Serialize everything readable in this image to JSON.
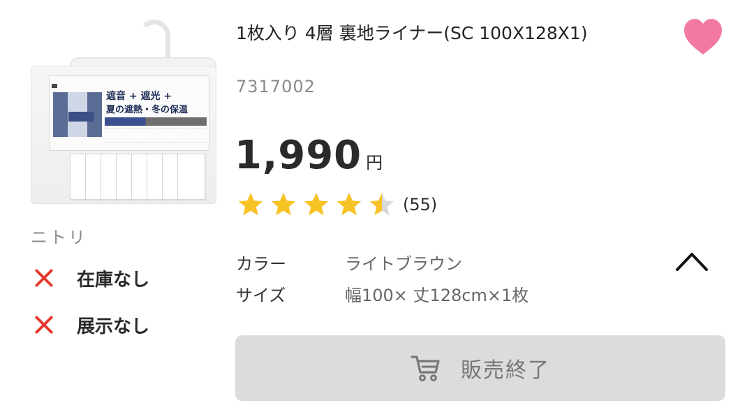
{
  "product": {
    "title": "1枚入り 4層 裏地ライナー(SC 100X128X1)",
    "sku": "7317002",
    "price": "1,990",
    "price_unit": "円",
    "rating_value": 4.5,
    "rating_max": 5,
    "review_count": "(55)",
    "image_label_line1": "遮音 + 遮光 +",
    "image_label_line2": "夏の遮熱・冬の保温"
  },
  "store": {
    "maker": "ニトリ",
    "stock": [
      {
        "status_icon": "close-icon",
        "label": "在庫なし"
      },
      {
        "status_icon": "close-icon",
        "label": "展示なし"
      }
    ]
  },
  "specs": [
    {
      "key": "カラー",
      "value": "ライトブラウン"
    },
    {
      "key": "サイズ",
      "value": "幅100× 丈128cm×1枚"
    }
  ],
  "actions": {
    "favorite_icon": "heart-icon",
    "collapse_icon": "chevron-up-icon",
    "buy_label": "販売終了",
    "buy_icon": "cart-icon"
  },
  "colors": {
    "heart": "#f27aa0",
    "star": "#f7c325",
    "star_empty": "#d9d9d9",
    "unavailable_x": "#e43a2f",
    "disabled_button": "#dcdcdc"
  }
}
